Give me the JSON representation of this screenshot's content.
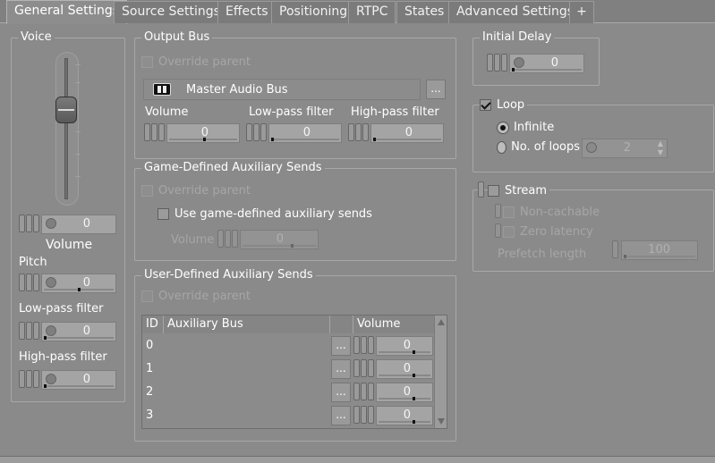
{
  "tabs": [
    {
      "label": "General Settings",
      "active": true
    },
    {
      "label": "Source Settings"
    },
    {
      "label": "Effects"
    },
    {
      "label": "Positioning"
    },
    {
      "label": "RTPC"
    },
    {
      "label": "States"
    },
    {
      "label": "Advanced Settings"
    },
    {
      "label": "+"
    }
  ],
  "voice": {
    "title": "Voice",
    "volume_value": "0",
    "volume_label": "Volume",
    "pitch_label": "Pitch",
    "pitch_value": "0",
    "lowpass_label": "Low-pass filter",
    "lowpass_value": "0",
    "highpass_label": "High-pass filter",
    "highpass_value": "0"
  },
  "output_bus": {
    "title": "Output Bus",
    "override_label": "Override parent",
    "bus_name": "Master Audio Bus",
    "browse_label": "...",
    "volume_label": "Volume",
    "volume_value": "0",
    "lowpass_label": "Low-pass filter",
    "lowpass_value": "0",
    "highpass_label": "High-pass filter",
    "highpass_value": "0"
  },
  "game_aux": {
    "title": "Game-Defined Auxiliary Sends",
    "override_label": "Override parent",
    "use_label": "Use game-defined auxiliary sends",
    "volume_label": "Volume",
    "volume_value": "0"
  },
  "user_aux": {
    "title": "User-Defined Auxiliary Sends",
    "override_label": "Override parent",
    "columns": [
      "ID",
      "Auxiliary Bus",
      "Volume"
    ],
    "rows": [
      {
        "id": "0",
        "browse": "...",
        "volume": "0"
      },
      {
        "id": "1",
        "browse": "...",
        "volume": "0"
      },
      {
        "id": "2",
        "browse": "...",
        "volume": "0"
      },
      {
        "id": "3",
        "browse": "...",
        "volume": "0"
      }
    ]
  },
  "initial_delay": {
    "title": "Initial Delay",
    "value": "0"
  },
  "loop": {
    "title": "Loop",
    "checked": true,
    "infinite_label": "Infinite",
    "noloops_label": "No. of loops",
    "noloops_value": "2"
  },
  "stream": {
    "title": "Stream",
    "noncachable_label": "Non-cachable",
    "zerolatency_label": "Zero latency",
    "prefetch_label": "Prefetch length",
    "prefetch_value": "100"
  }
}
